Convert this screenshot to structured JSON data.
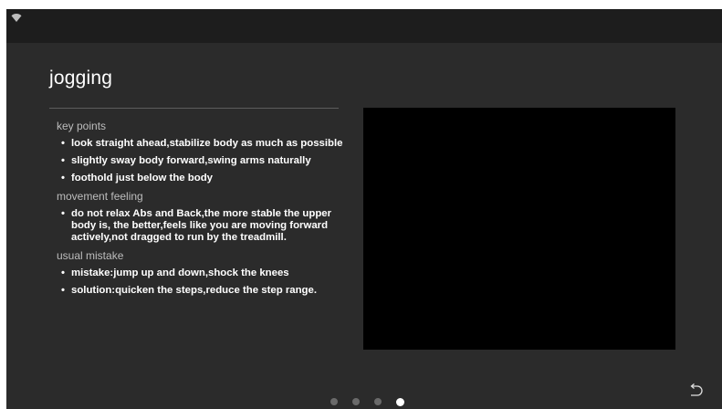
{
  "title": "jogging",
  "sections": [
    {
      "heading": "key points",
      "items": [
        "look straight ahead,stabilize body as much as possible",
        "slightly sway body forward,swing arms naturally",
        "foothold just below the body"
      ]
    },
    {
      "heading": "movement feeling",
      "items": [
        "do not relax Abs and Back,the more stable the upper body is, the better,feels like you are moving forward actively,not dragged to run by the treadmill."
      ]
    },
    {
      "heading": "usual mistake",
      "items": [
        "mistake:jump up and down,shock the knees",
        "solution:quicken the steps,reduce the step range."
      ]
    }
  ],
  "pagination": {
    "total": 4,
    "current": 4
  },
  "icons": {
    "status": "wifi-icon",
    "back": "back-icon"
  },
  "colors": {
    "background": "#2b2b2b",
    "status_bar": "#1d1d1d",
    "video": "#000000",
    "text": "#ffffff",
    "heading": "#bdbdbd"
  }
}
